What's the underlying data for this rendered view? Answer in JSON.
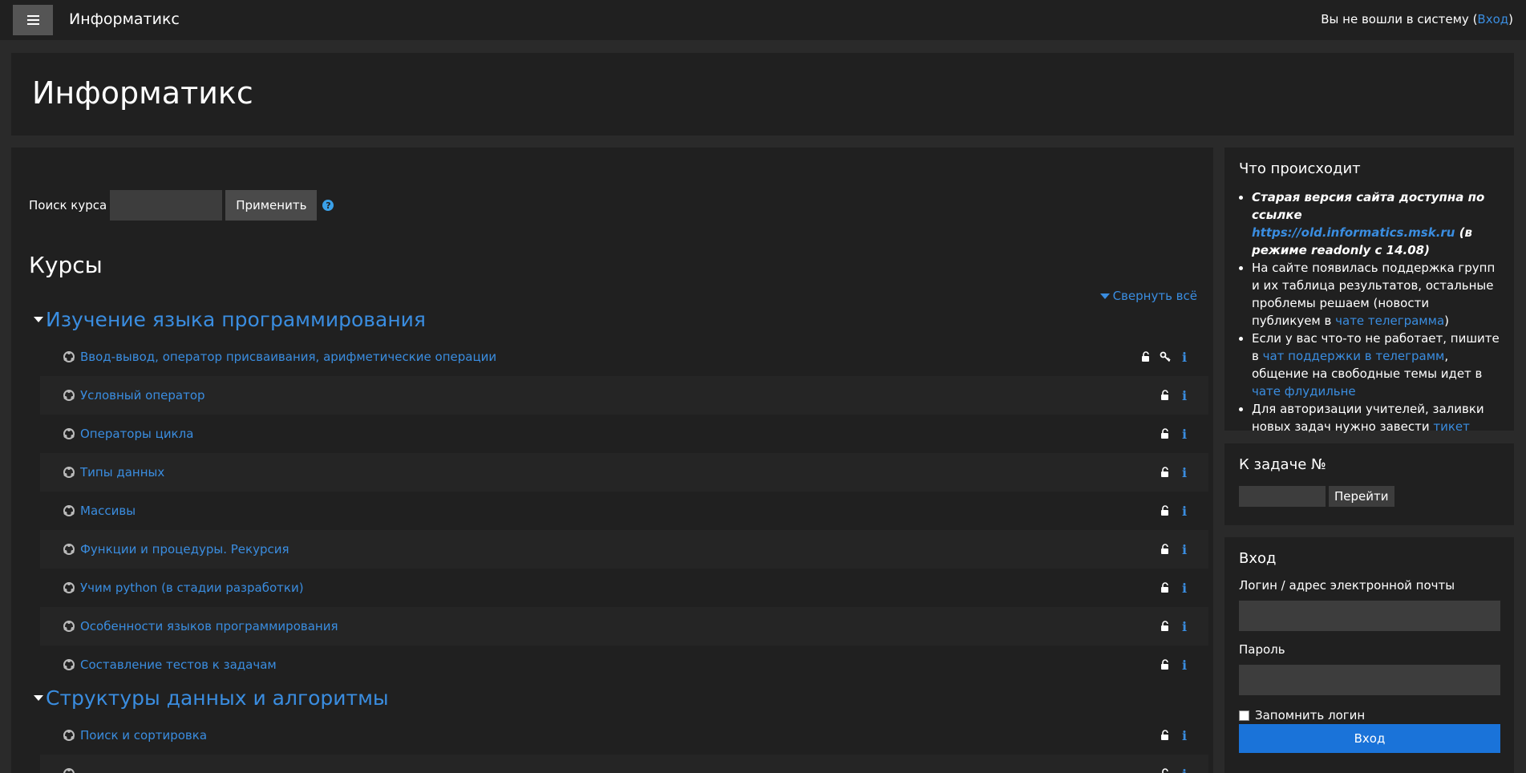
{
  "navbar": {
    "brand": "Информатикс",
    "login_prefix": "Вы не вошли в систему (",
    "login_link": "Вход",
    "login_suffix": ")"
  },
  "header": {
    "title": "Информатикс"
  },
  "search": {
    "label": "Поиск курса",
    "value": "",
    "button": "Применить",
    "help_icon": "question-circle-icon"
  },
  "courses": {
    "title": "Курсы",
    "collapse_all": "Свернуть всё",
    "categories": [
      {
        "name": "Изучение языка программирования",
        "courses": [
          "Ввод-вывод, оператор присваивания, арифметические операции",
          "Условный оператор",
          "Операторы цикла",
          "Типы данных",
          "Массивы",
          "Функции и процедуры. Рекурсия",
          "Учим python (в стадии разработки)",
          "Особенности языков программирования",
          "Составление тестов к задачам"
        ]
      },
      {
        "name": "Структуры данных и алгоритмы",
        "courses": [
          "Поиск и сортировка"
        ]
      }
    ]
  },
  "news": {
    "title": "Что происходит",
    "item1_bold": "Старая версия сайта доступна  по ссылке ",
    "item1_link": "https://old.informatics.msk.ru",
    "item1_tail": " (в режиме readonly с 14.08)",
    "item2_text": "На сайте появилась поддержка групп и их таблица результатов, остальные проблемы решаем (новости публикуем в ",
    "item2_link": "чате телеграмма",
    "item2_tail": ")",
    "item3_text": "Если у вас что-то не работает, пишите в ",
    "item3_link1": "чат поддержки в телеграмм",
    "item3_mid": ", общение на свободные темы  идет в ",
    "item3_link2": "чате флудильне",
    "item4_text": "Для авторизации учителей, заливки новых задач нужно завести ",
    "item4_link": "тикет"
  },
  "goto": {
    "title": "К задаче №",
    "value": "",
    "button": "Перейти"
  },
  "login": {
    "title": "Вход",
    "username_label": "Логин / адрес электронной почты",
    "password_label": "Пароль",
    "remember_label": "Запомнить логин",
    "submit": "Вход"
  },
  "colors": {
    "accent": "#3a8de0",
    "background": "#2a2a2a",
    "panel": "#202020",
    "primary_button": "#1a73d9"
  }
}
